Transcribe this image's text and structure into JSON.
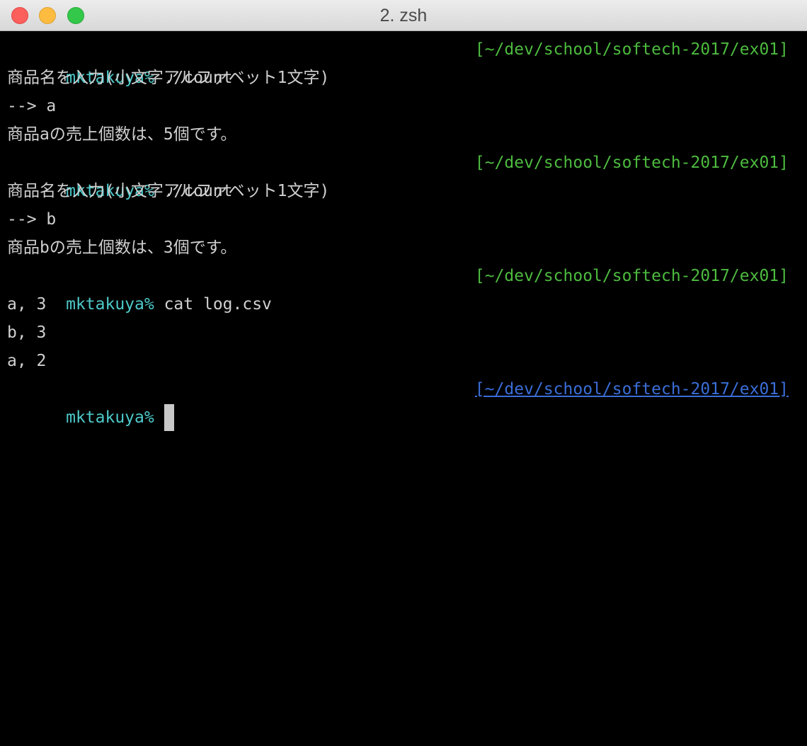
{
  "window": {
    "title": "2. zsh"
  },
  "terminal": {
    "prompt_user": "mktakuya%",
    "lines": [
      {
        "type": "prompt",
        "command": "./count",
        "rprompt": "[~/dev/school/softech-2017/ex01]"
      },
      {
        "type": "output",
        "text": "商品名を入力(小文字アルファベット1文字)"
      },
      {
        "type": "output",
        "text": "--> a"
      },
      {
        "type": "output",
        "text": "商品aの売上個数は、5個です。"
      },
      {
        "type": "prompt",
        "command": "./count",
        "rprompt": "[~/dev/school/softech-2017/ex01]"
      },
      {
        "type": "output",
        "text": "商品名を入力(小文字アルファベット1文字)"
      },
      {
        "type": "output",
        "text": "--> b"
      },
      {
        "type": "output",
        "text": "商品bの売上個数は、3個です。"
      },
      {
        "type": "prompt",
        "command": "cat log.csv",
        "rprompt": "[~/dev/school/softech-2017/ex01]"
      },
      {
        "type": "output",
        "text": "a, 3"
      },
      {
        "type": "output",
        "text": "b, 3"
      },
      {
        "type": "output",
        "text": "a, 2"
      }
    ],
    "current_prompt": {
      "command": "",
      "rprompt": "[~/dev/school/softech-2017/ex01]"
    }
  },
  "colors": {
    "user": "#4ec9c9",
    "path": "#4dbb3f",
    "active_path": "#3a6ed8",
    "text": "#d0d0d0",
    "background": "#000000"
  }
}
